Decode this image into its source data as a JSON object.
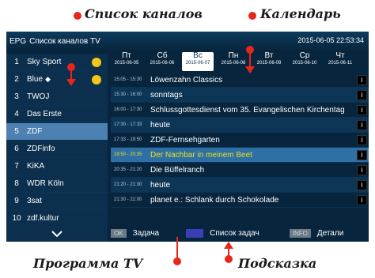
{
  "annotations": {
    "channels": "Список каналов",
    "calendar": "Календарь",
    "program": "Программа TV",
    "hint": "Подсказка"
  },
  "header": {
    "epg": "EPG",
    "title": "Список каналов TV",
    "datetime": "2015-06-05 22:53:34"
  },
  "channels": [
    {
      "num": "1",
      "name": "Sky Sport",
      "favorite": true
    },
    {
      "num": "2",
      "name": "Blue",
      "favorite": true,
      "icon": "diamond-icon"
    },
    {
      "num": "3",
      "name": "TWOJ"
    },
    {
      "num": "4",
      "name": "Das Erste"
    },
    {
      "num": "5",
      "name": "ZDF",
      "active": true
    },
    {
      "num": "6",
      "name": "ZDFinfo"
    },
    {
      "num": "7",
      "name": "KiKA"
    },
    {
      "num": "8",
      "name": "WDR Köln"
    },
    {
      "num": "9",
      "name": "3sat"
    },
    {
      "num": "10",
      "name": "zdf.kultur"
    }
  ],
  "days": [
    {
      "name": "Пт",
      "date": "2015-06-05"
    },
    {
      "name": "Сб",
      "date": "2015-06-06"
    },
    {
      "name": "Вс",
      "date": "2015-06-07",
      "active": true
    },
    {
      "name": "Пн",
      "date": "2015-06-08"
    },
    {
      "name": "Вт",
      "date": "2015-06-09"
    },
    {
      "name": "Ср",
      "date": "2015-06-10"
    },
    {
      "name": "Чт",
      "date": "2015-06-11"
    }
  ],
  "programs": [
    {
      "time": "15:05 - 15:30",
      "title": "Löwenzahn Classics"
    },
    {
      "time": "15:30 - 16:00",
      "title": "sonntags"
    },
    {
      "time": "16:00 - 17:30",
      "title": "Schlussgottesdienst vom 35. Evangelischen Kirchentag"
    },
    {
      "time": "17:30 - 17:33",
      "title": "heute"
    },
    {
      "time": "17:33 - 19:50",
      "title": "ZDF-Fernsehgarten"
    },
    {
      "time": "19:50 - 20:35",
      "title": "Der Nachbar in meinem Beet",
      "current": true
    },
    {
      "time": "20:35 - 21:20",
      "title": "Die Büffelranch"
    },
    {
      "time": "21:20 - 21:30",
      "title": "heute"
    },
    {
      "time": "21:30 - 22:00",
      "title": "planet e.: Schlank durch Schokolade"
    }
  ],
  "info_label": "i",
  "hint": {
    "ok_key": "OK",
    "ok_label": "Задача",
    "blue_label": "Список задач",
    "info_key": "INFO",
    "info_label": "Детали"
  },
  "colors": {
    "background": "#07253d",
    "active_row": "#4d81b2",
    "current_program": "#2e6fa6",
    "current_text": "#e8e020",
    "favorite": "#f5c518",
    "annotation_marker": "#e8261a",
    "blue_key": "#3b3fb6"
  }
}
